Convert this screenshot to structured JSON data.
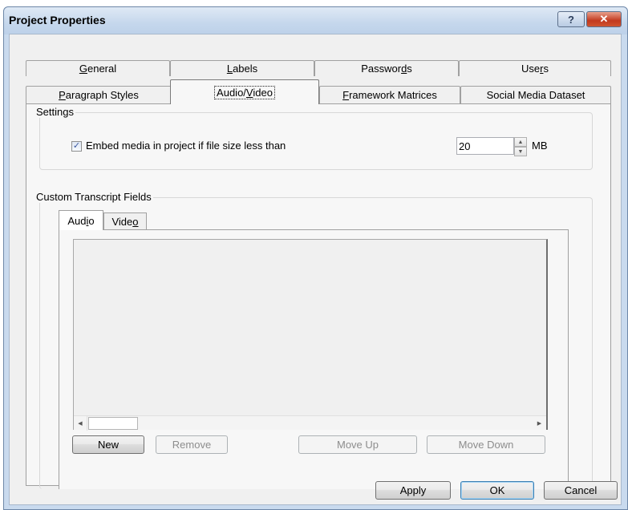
{
  "window": {
    "title": "Project Properties",
    "help_label": "?",
    "close_label": "✕"
  },
  "tabs_row1": [
    {
      "label_pre": "",
      "label_u": "G",
      "label_post": "eneral"
    },
    {
      "label_pre": "",
      "label_u": "L",
      "label_post": "abels"
    },
    {
      "label_pre": "Passwor",
      "label_u": "d",
      "label_post": "s"
    },
    {
      "label_pre": "Use",
      "label_u": "r",
      "label_post": "s"
    }
  ],
  "tabs_row2": [
    {
      "label_pre": "",
      "label_u": "P",
      "label_post": "aragraph Styles"
    },
    {
      "label_pre": "Audio/",
      "label_u": "V",
      "label_post": "ideo"
    },
    {
      "label_pre": "",
      "label_u": "F",
      "label_post": "ramework Matrices"
    },
    {
      "label_pre": "Social Media Dataset",
      "label_u": "",
      "label_post": ""
    }
  ],
  "settings": {
    "group_label": "Settings",
    "embed_label": "Embed media in project if file size less than",
    "embed_checked": "✓",
    "size_value": "20",
    "unit": "MB"
  },
  "custom": {
    "group_label": "Custom Transcript Fields",
    "subtabs": [
      {
        "label_pre": "Aud",
        "label_u": "i",
        "label_post": "o"
      },
      {
        "label_pre": "Vide",
        "label_u": "o",
        "label_post": ""
      }
    ],
    "buttons": {
      "new": "New",
      "remove": "Remove",
      "move_up": "Move Up",
      "move_down": "Move Down"
    }
  },
  "footer": {
    "apply": "Apply",
    "ok": "OK",
    "cancel": "Cancel"
  },
  "colors": {
    "titlebar": "#c5d7ec",
    "close": "#c2391e",
    "panel": "#f7f7f7"
  },
  "icons": {
    "scroll_left": "◀",
    "scroll_right": "▶",
    "spin_up": "▲",
    "spin_down": "▼"
  }
}
